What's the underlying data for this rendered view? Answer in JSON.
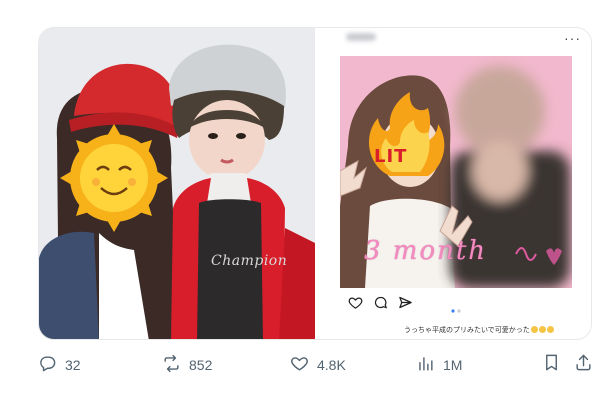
{
  "post": {
    "media": {
      "left_photo": {
        "alt_icons": [
          "sun-face-emoji-icon"
        ],
        "shirt_text": "Champion"
      },
      "right_post": {
        "more_label": "···",
        "photo": {
          "sticker": "LIT",
          "handwritten": "3 month"
        },
        "caption": "うっちゃ平成のプリみたいで可愛かった"
      }
    },
    "actions": {
      "replies": "32",
      "reposts": "852",
      "likes": "4.8K",
      "views": "1M"
    }
  },
  "colors": {
    "icon_gray": "#536471",
    "border": "#e6e8ea",
    "pink_bg": "#f3b9cf",
    "red_jacket": "#d81e2b"
  }
}
